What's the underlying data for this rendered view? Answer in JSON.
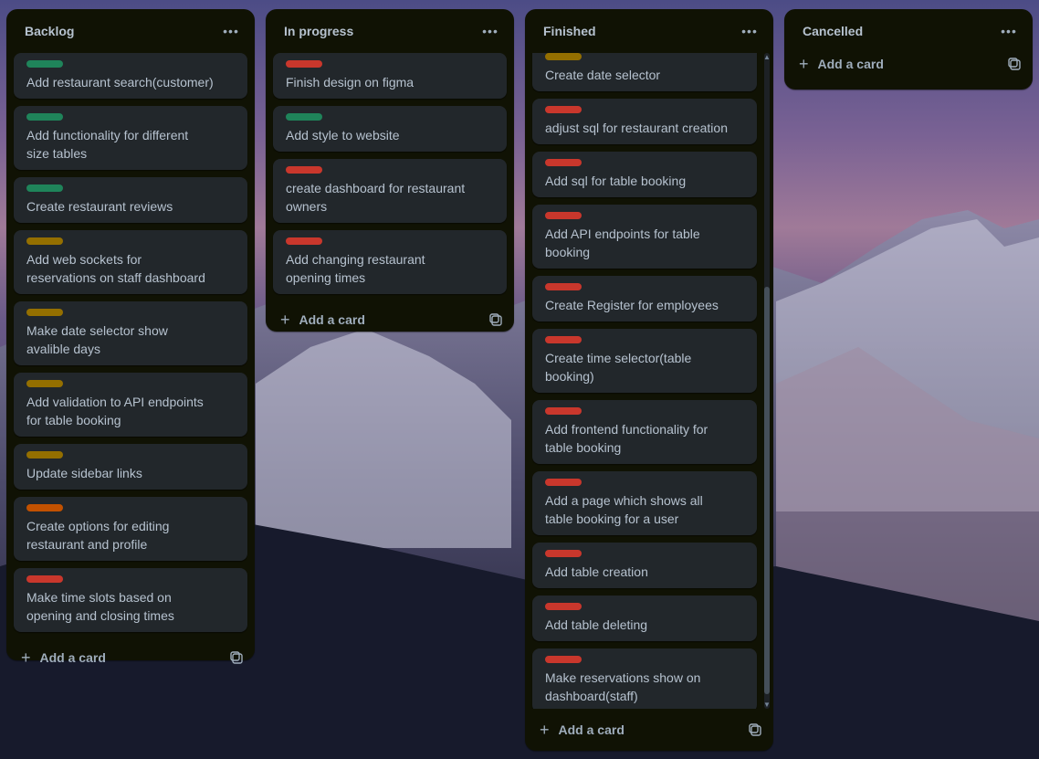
{
  "colors": {
    "green": "#4bce97",
    "greenDark": "#1f845a",
    "yellow": "#946f00",
    "orange": "#c25100",
    "red": "#c9372c",
    "listBg": "#101204",
    "cardBg": "#22272b",
    "text": "#b6c2cf"
  },
  "icons": {
    "more": "more-icon",
    "add": "plus-icon",
    "template": "template-icon"
  },
  "lists": {
    "backlog": {
      "title": "Backlog",
      "add_label": "Add a card",
      "cards": [
        {
          "label_color": "#1f845a",
          "text": "Add restaurant search(customer)"
        },
        {
          "label_color": "#1f845a",
          "text": "Add functionality for different size tables"
        },
        {
          "label_color": "#1f845a",
          "text": "Create restaurant reviews"
        },
        {
          "label_color": "#946f00",
          "text": "Add web sockets for reservations on staff dashboard"
        },
        {
          "label_color": "#946f00",
          "text": "Make date selector show avalible days"
        },
        {
          "label_color": "#946f00",
          "text": "Add validation to API endpoints for table booking"
        },
        {
          "label_color": "#946f00",
          "text": "Update sidebar links"
        },
        {
          "label_color": "#c25100",
          "text": "Create options for editing restaurant and profile"
        },
        {
          "label_color": "#c9372c",
          "text": "Make time slots based on opening and closing times"
        }
      ]
    },
    "inprogress": {
      "title": "In progress",
      "add_label": "Add a card",
      "cards": [
        {
          "label_color": "#c9372c",
          "text": "Finish design on figma"
        },
        {
          "label_color": "#1f845a",
          "text": "Add style to website"
        },
        {
          "label_color": "#c9372c",
          "text": "create dashboard for restaurant owners"
        },
        {
          "label_color": "#c9372c",
          "text": "Add changing restaurant opening times"
        }
      ]
    },
    "finished": {
      "title": "Finished",
      "add_label": "Add a card",
      "scroll_fraction": 0.58,
      "cards": [
        {
          "label_color": "#946f00",
          "text": "Create date selector"
        },
        {
          "label_color": "#c9372c",
          "text": "adjust sql for restaurant creation"
        },
        {
          "label_color": "#c9372c",
          "text": "Add sql for table booking"
        },
        {
          "label_color": "#c9372c",
          "text": "Add API endpoints for table booking"
        },
        {
          "label_color": "#c9372c",
          "text": "Create Register for employees"
        },
        {
          "label_color": "#c9372c",
          "text": "Create time selector(table booking)"
        },
        {
          "label_color": "#c9372c",
          "text": "Add frontend functionality for table booking"
        },
        {
          "label_color": "#c9372c",
          "text": "Add a page which shows all table booking for a user"
        },
        {
          "label_color": "#c9372c",
          "text": "Add table creation"
        },
        {
          "label_color": "#c9372c",
          "text": "Add table deleting"
        },
        {
          "label_color": "#c9372c",
          "text": "Make reservations show on dashboard(staff)"
        }
      ]
    },
    "cancelled": {
      "title": "Cancelled",
      "add_label": "Add a card",
      "cards": []
    }
  }
}
